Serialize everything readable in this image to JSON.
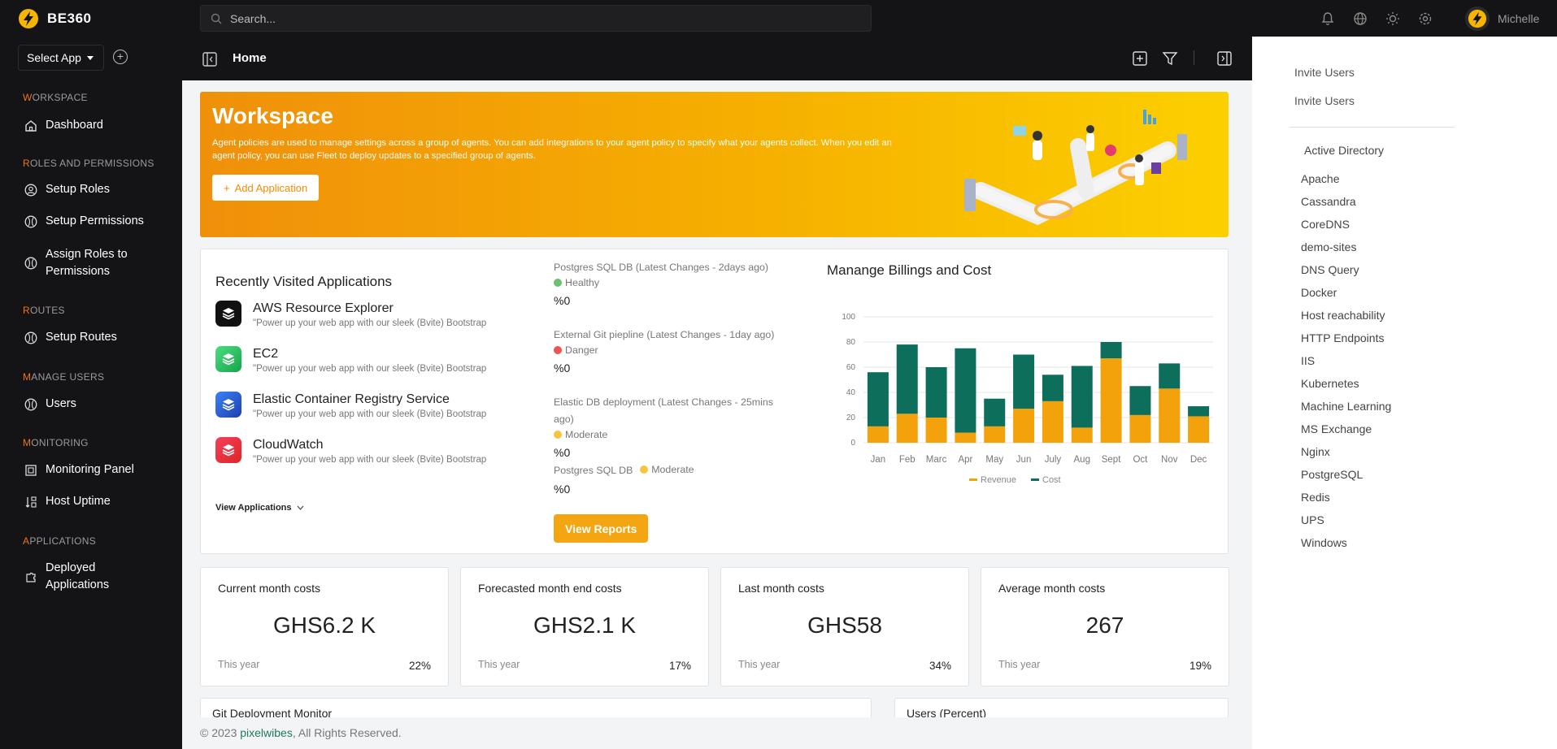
{
  "app": {
    "name": "BE360"
  },
  "search": {
    "placeholder": "Search..."
  },
  "user": {
    "name": "Michelle"
  },
  "sidebar": {
    "select_app": "Select App",
    "sections": [
      {
        "first": "W",
        "rest": "ORKSPACE",
        "items": [
          {
            "label": "Dashboard",
            "icon": "home-icon"
          }
        ]
      },
      {
        "first": "R",
        "rest": "OLES AND PERMISSIONS",
        "items": [
          {
            "label": "Setup Roles",
            "icon": "user-circle-icon"
          },
          {
            "label": "Setup Permissions",
            "icon": "key-icon"
          },
          {
            "label": "Assign Roles to Permissions",
            "icon": "link-icon"
          }
        ]
      },
      {
        "first": "R",
        "rest": "OUTES",
        "items": [
          {
            "label": "Setup Routes",
            "icon": "route-icon"
          }
        ]
      },
      {
        "first": "M",
        "rest": "ANAGE USERS",
        "items": [
          {
            "label": "Users",
            "icon": "users-icon"
          }
        ]
      },
      {
        "first": "M",
        "rest": "ONITORING",
        "items": [
          {
            "label": "Monitoring Panel",
            "icon": "monitor-icon"
          },
          {
            "label": "Host Uptime",
            "icon": "sort-icon"
          }
        ]
      },
      {
        "first": "A",
        "rest": "PPLICATIONS",
        "items": [
          {
            "label": "Deployed Applications",
            "icon": "puzzle-icon"
          }
        ]
      }
    ]
  },
  "breadcrumb": {
    "current": "Home"
  },
  "hero": {
    "title": "Workspace",
    "text": "Agent policies are used to manage settings across a group of agents. You can add integrations to your agent policy to specify what your agents collect. When you edit an agent policy, you can use Fleet to deploy updates to a specified group of agents.",
    "button": "Add Application",
    "button_plus": "+"
  },
  "recent": {
    "title": "Recently Visited Applications",
    "apps": [
      {
        "name": "AWS Resource Explorer",
        "desc": "\"Power up your web app with our sleek (Bvite) Bootstrap",
        "color": "#111111"
      },
      {
        "name": "EC2",
        "desc": "\"Power up your web app with our sleek (Bvite) Bootstrap",
        "color": "#22c55e"
      },
      {
        "name": "Elastic Container Registry Service",
        "desc": "\"Power up your web app with our sleek (Bvite) Bootstrap",
        "color": "#1d5fd6"
      },
      {
        "name": "CloudWatch",
        "desc": "\"Power up your web app with our sleek (Bvite) Bootstrap",
        "color": "#ec2b3b"
      }
    ],
    "view_all": "View Applications"
  },
  "statuses": [
    {
      "title": "Postgres SQL DB (Latest Changes - 2days ago)",
      "badge": "Healthy",
      "value": "%0",
      "color": "#6cc070"
    },
    {
      "title": "External Git piepline (Latest Changes - 1day ago)",
      "badge": "Danger",
      "value": "%0",
      "color": "#ef5350"
    },
    {
      "title": "Elastic DB deployment (Latest Changes - 25mins ago)",
      "badge": "Moderate",
      "value": "%0",
      "color": "#f5c542"
    },
    {
      "title": "Postgres SQL DB",
      "badge": "Moderate",
      "value": "%0",
      "color": "#f5c542"
    }
  ],
  "view_reports": "View Reports",
  "chart_title": "Manange Billings and Cost",
  "chart_data": {
    "type": "bar",
    "stacked": true,
    "categories": [
      "Jan",
      "Feb",
      "Marc",
      "Apr",
      "May",
      "Jun",
      "July",
      "Aug",
      "Sept",
      "Oct",
      "Nov",
      "Dec"
    ],
    "series": [
      {
        "name": "Revenue",
        "color": "#f4a20c",
        "values": [
          13,
          23,
          20,
          8,
          13,
          27,
          33,
          12,
          67,
          22,
          43,
          21
        ]
      },
      {
        "name": "Cost",
        "color": "#0d6e5b",
        "values": [
          43,
          55,
          40,
          67,
          22,
          43,
          21,
          49,
          13,
          23,
          20,
          8
        ]
      }
    ],
    "yticks": [
      0,
      20,
      40,
      60,
      80,
      100
    ],
    "ylim": [
      0,
      100
    ],
    "grid": true,
    "legend": "bottom"
  },
  "stats": [
    {
      "title": "Current month costs",
      "value": "GHS6.2 K",
      "sub": "This year",
      "pct": "22%"
    },
    {
      "title": "Forecasted month end costs",
      "value": "GHS2.1 K",
      "sub": "This year",
      "pct": "17%"
    },
    {
      "title": "Last month costs",
      "value": "GHS58",
      "sub": "This year",
      "pct": "34%"
    },
    {
      "title": "Average month costs",
      "value": "267",
      "sub": "This year",
      "pct": "19%"
    }
  ],
  "bottom_cards": [
    {
      "title": "Git Deployment Monitor"
    },
    {
      "title": "Users (Percent)"
    }
  ],
  "footer": {
    "prefix": "© 2023",
    "brand": "pixelwibes",
    "suffix": ", All Rights Reserved."
  },
  "right_panel": {
    "links": [
      "Invite Users",
      "Invite Users"
    ],
    "heading": "Active Directory",
    "items": [
      "Apache",
      "Cassandra",
      "CoreDNS",
      "demo-sites",
      "DNS Query",
      "Docker",
      "Host reachability",
      "HTTP Endpoints",
      "IIS",
      "Kubernetes",
      "Machine Learning",
      "MS Exchange",
      "Nginx",
      "PostgreSQL",
      "Redis",
      "UPS",
      "Windows"
    ]
  }
}
